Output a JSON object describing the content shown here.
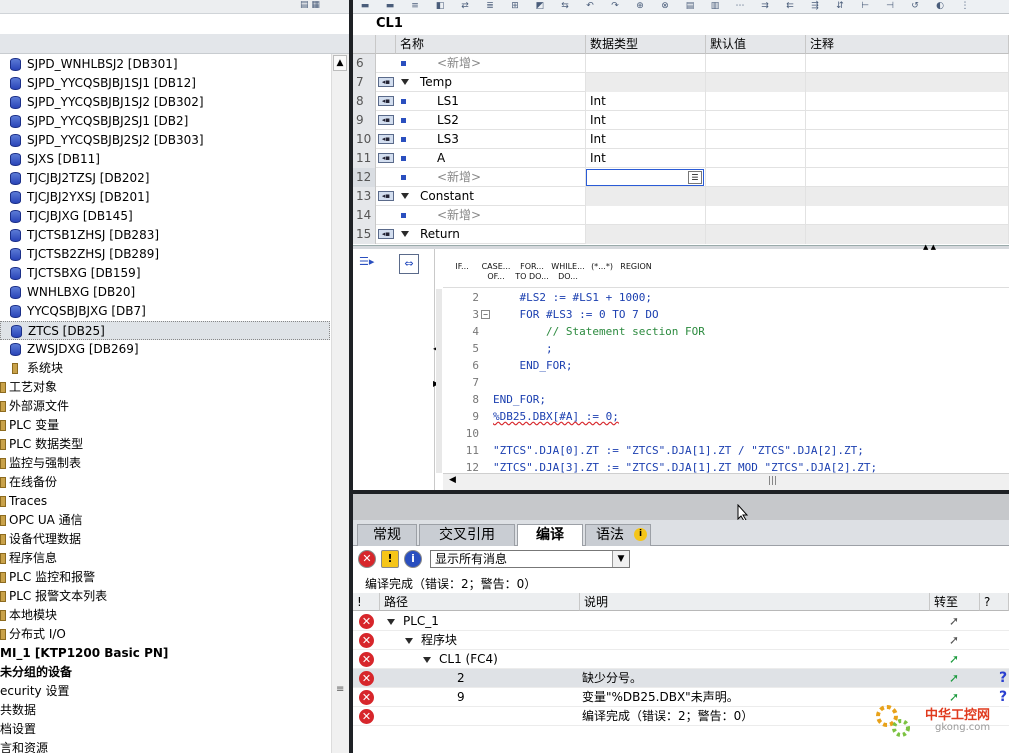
{
  "left_tree": {
    "db_items": [
      "SJPD_WNHLBSJ2 [DB301]",
      "SJPD_YYCQSBJBJ1SJ1 [DB12]",
      "SJPD_YYCQSBJBJ1SJ2 [DB302]",
      "SJPD_YYCQSBJBJ2SJ1 [DB2]",
      "SJPD_YYCQSBJBJ2SJ2 [DB303]",
      "SJXS [DB11]",
      "TJCJBJ2TZSJ [DB202]",
      "TJCJBJ2YXSJ [DB201]",
      "TJCJBJXG [DB145]",
      "TJCTSB1ZHSJ [DB283]",
      "TJCTSB2ZHSJ [DB289]",
      "TJCTSBXG [DB159]",
      "WNHLBXG [DB20]",
      "YYCQSBJBJXG [DB7]",
      "ZTCS [DB25]",
      "ZWSJDXG [DB269]"
    ],
    "system_blocks": "系统块",
    "level2_items": [
      "工艺对象",
      "外部源文件",
      "PLC 变量",
      "PLC 数据类型",
      "监控与强制表",
      "在线备份",
      "Traces",
      "OPC UA 通信",
      "设备代理数据",
      "程序信息",
      "PLC 监控和报警",
      "PLC 报警文本列表",
      "本地模块",
      "分布式 I/O"
    ],
    "level1_items": [
      "MI_1 [KTP1200 Basic PN]",
      "未分组的设备",
      "ecurity 设置",
      "共数据",
      "档设置",
      "言和资源"
    ]
  },
  "block_title": "CL1",
  "interface": {
    "headers": {
      "name": "名称",
      "type": "数据类型",
      "default": "默认值",
      "comment": "注释"
    },
    "rows": [
      {
        "num": "6",
        "name": "<新增>",
        "type": "",
        "kind": "new"
      },
      {
        "num": "7",
        "name": "Temp",
        "type": "",
        "kind": "section"
      },
      {
        "num": "8",
        "name": "LS1",
        "type": "Int",
        "kind": "var"
      },
      {
        "num": "9",
        "name": "LS2",
        "type": "Int",
        "kind": "var"
      },
      {
        "num": "10",
        "name": "LS3",
        "type": "Int",
        "kind": "var"
      },
      {
        "num": "11",
        "name": "A",
        "type": "Int",
        "kind": "var"
      },
      {
        "num": "12",
        "name": "<新增>",
        "type": "",
        "kind": "new-editing"
      },
      {
        "num": "13",
        "name": "Constant",
        "type": "",
        "kind": "section"
      },
      {
        "num": "14",
        "name": "<新增>",
        "type": "",
        "kind": "new"
      },
      {
        "num": "15",
        "name": "Return",
        "type": "",
        "kind": "section"
      }
    ]
  },
  "code_toolbar": {
    "keywords": [
      "IF...",
      "CASE... OF...",
      "FOR... TO DO...",
      "WHILE... DO...",
      "(*...*)",
      "REGION"
    ]
  },
  "code_lines": [
    {
      "num": "2",
      "text": "    #LS2 := #LS1 + 1000;"
    },
    {
      "num": "3",
      "text": "    FOR #LS3 := 0 TO 7 DO"
    },
    {
      "num": "4",
      "text": "        // Statement section FOR"
    },
    {
      "num": "5",
      "text": "        ;"
    },
    {
      "num": "6",
      "text": "    END_FOR;"
    },
    {
      "num": "7",
      "text": ""
    },
    {
      "num": "8",
      "text": "END_FOR;"
    },
    {
      "num": "9",
      "text": "%DB25.DBX[#A] := 0;"
    },
    {
      "num": "10",
      "text": ""
    },
    {
      "num": "11",
      "text": "\"ZTCS\".DJA[0].ZT := \"ZTCS\".DJA[1].ZT / \"ZTCS\".DJA[2].ZT;"
    },
    {
      "num": "12",
      "text": "\"ZTCS\".DJA[3].ZT := \"ZTCS\".DJA[1].ZT MOD \"ZTCS\".DJA[2].ZT;"
    }
  ],
  "inspector": {
    "tabs": [
      "常规",
      "交叉引用",
      "编译",
      "语法"
    ],
    "active_tab": "编译",
    "filter_value": "显示所有消息",
    "summary": "编译完成（错误：2；警告：0）",
    "headers": {
      "bang": "!",
      "path": "路径",
      "desc": "说明",
      "goto": "转至",
      "q": "?"
    },
    "messages": [
      {
        "path": "PLC_1",
        "indent": 1,
        "desc": ""
      },
      {
        "path": "程序块",
        "indent": 2,
        "desc": ""
      },
      {
        "path": "CL1 (FC4)",
        "indent": 3,
        "desc": ""
      },
      {
        "path": "2",
        "indent": 4,
        "desc": "缺少分号。"
      },
      {
        "path": "9",
        "indent": 4,
        "desc": "变量\"%DB25.DBX\"未声明。"
      },
      {
        "path": "",
        "indent": 0,
        "desc": "编译完成（错误：2；警告：0）"
      }
    ]
  },
  "watermark": {
    "text": "中华工控网",
    "url": "gkong.com"
  }
}
